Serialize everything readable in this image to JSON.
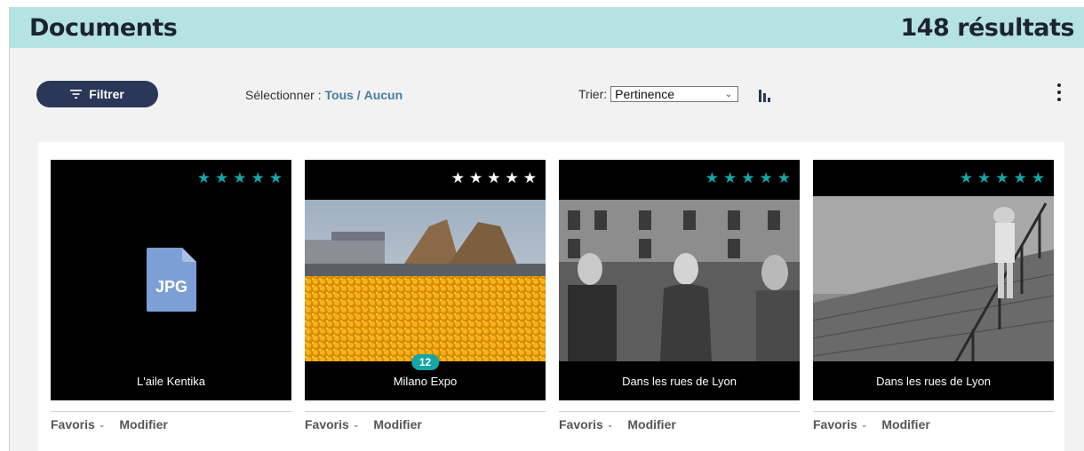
{
  "header": {
    "title": "Documents",
    "count": "148 résultats"
  },
  "toolbar": {
    "filter_label": "Filtrer",
    "select_label": "Sélectionner :",
    "select_all": "Tous",
    "select_sep": "/",
    "select_none": "Aucun",
    "sort_label": "Trier:",
    "sort_value": "Pertinence"
  },
  "colors": {
    "header_bg": "#b5e3e3",
    "accent": "#16a6a6",
    "button": "#2a3758"
  },
  "cards": [
    {
      "caption": "L'aile Kentika",
      "star_color": "#16a6a6",
      "type_label": "JPG",
      "favorites": "Favoris",
      "edit": "Modifier"
    },
    {
      "caption": "Milano Expo",
      "star_color": "#ffffff",
      "badge": "12",
      "favorites": "Favoris",
      "edit": "Modifier"
    },
    {
      "caption": "Dans les rues de Lyon",
      "star_color": "#16a6a6",
      "favorites": "Favoris",
      "edit": "Modifier"
    },
    {
      "caption": "Dans les rues de Lyon",
      "star_color": "#16a6a6",
      "favorites": "Favoris",
      "edit": "Modifier"
    }
  ]
}
